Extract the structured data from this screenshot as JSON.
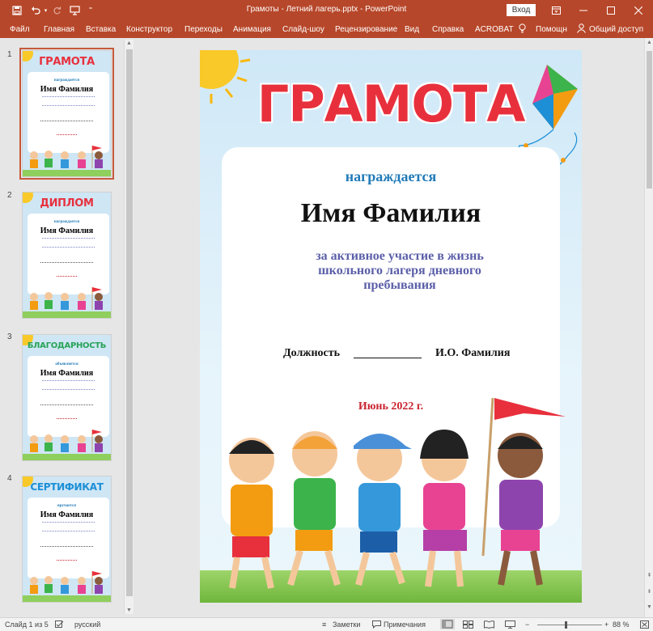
{
  "titlebar": {
    "doc_title": "Грамоты - Летний лагерь.pptx  -  PowerPoint",
    "signin": "Вход"
  },
  "ribbon": {
    "tabs": [
      "Файл",
      "Главная",
      "Вставка",
      "Конструктор",
      "Переходы",
      "Анимация",
      "Слайд-шоу",
      "Рецензирование",
      "Вид",
      "Справка",
      "ACROBAT"
    ],
    "tell_me": "Помощн",
    "share": "Общий доступ"
  },
  "thumbnails": [
    {
      "num": "1",
      "title": "ГРАМОТА",
      "awarded": "награждается",
      "name": "Имя Фамилия",
      "color": "#e8303d"
    },
    {
      "num": "2",
      "title": "ДИПЛОМ",
      "awarded": "награждается",
      "name": "Имя Фамилия",
      "color": "#e8303d"
    },
    {
      "num": "3",
      "title": "БЛАГОДАРНОСТЬ",
      "awarded": "объявляется",
      "name": "Имя Фамилия",
      "color": "#27a356"
    },
    {
      "num": "4",
      "title": "СЕРТИФИКАТ",
      "awarded": "вручается",
      "name": "Имя Фамилия",
      "color": "#1c8fd6"
    }
  ],
  "slide": {
    "title": "ГРАМОТА",
    "awarded": "награждается",
    "name": "Имя Фамилия",
    "reason": "за активное участие в жизнь школьного лагеря дневного пребывания",
    "position": "Должность",
    "signer": "И.О. Фамилия",
    "date": "Июнь 2022 г."
  },
  "statusbar": {
    "slide_info": "Слайд 1 из 5",
    "language": "русский",
    "notes": "Заметки",
    "comments": "Примечания",
    "zoom": "88 %"
  },
  "colors": {
    "accent": "#b7472a",
    "title_red": "#e8303d",
    "awarded_blue": "#1f7ab8",
    "reason_purple": "#5b5fa8",
    "date_red": "#c9232f"
  }
}
